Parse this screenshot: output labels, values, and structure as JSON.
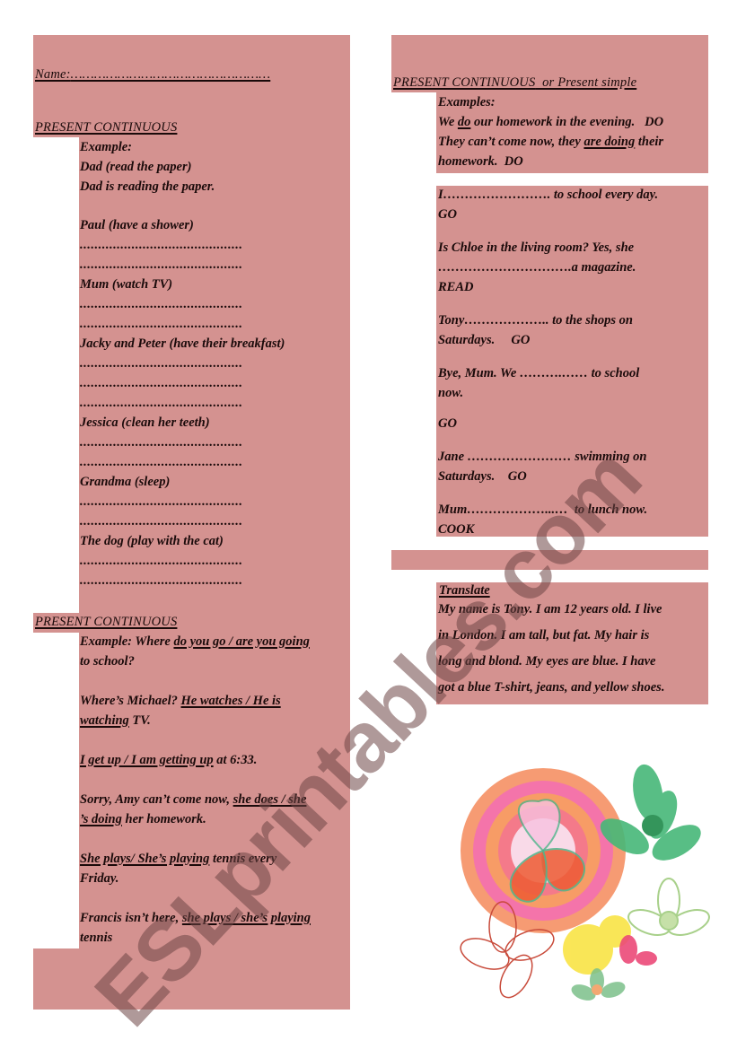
{
  "left": {
    "name_label": "Name:",
    "name_dots": "……………………………………………",
    "section1": {
      "title": "PRESENT CONTINUOUS",
      "example_label": "Example:",
      "example_prompt": "Dad (read the paper)",
      "example_answer": "Dad is reading the paper.",
      "blank": "............................................",
      "items": [
        {
          "prompt": "Paul (have a shower)",
          "blank_lines": 2
        },
        {
          "prompt": "Mum (watch TV)",
          "blank_lines": 2
        },
        {
          "prompt": "Jacky and Peter (have their breakfast)",
          "blank_lines": 3
        },
        {
          "prompt": "Jessica (clean her teeth)",
          "blank_lines": 2
        },
        {
          "prompt": "Grandma (sleep)",
          "blank_lines": 2
        },
        {
          "prompt": "The dog (play with the cat)",
          "blank_lines": 2
        }
      ]
    },
    "section2": {
      "title": "PRESENT CONTINUOUS",
      "example": {
        "pre": "Example: Where ",
        "choice": "do you go / are you going",
        "post": "",
        "line2": "to school?"
      },
      "items": [
        {
          "pre": "Where’s Michael? ",
          "choice1": "He watches / He is",
          "choice2": "watching",
          "post": " TV."
        },
        {
          "choice": "I get up / I am getting up",
          "post": " at 6:33."
        },
        {
          "pre": "Sorry, Amy can’t come now, ",
          "choice1": "she does / she",
          "choice2": "’s doing",
          "post": " her homework."
        },
        {
          "choice": "She plays/ She’s playing",
          "post": " tennis every",
          "line2": "Friday."
        },
        {
          "pre": "Francis isn’t here, ",
          "choice": "she plays / she’s playing",
          "line2": "tennis"
        }
      ]
    }
  },
  "right": {
    "section3": {
      "title_main": "PRESENT CONTINUOUS",
      "title_rest": "  or Present simple",
      "examples_label": "Examples:",
      "example1": {
        "pre": "We ",
        "u": "do",
        "post": " our homework in the evening.   DO"
      },
      "example2": {
        "pre": "They can’t come now, they ",
        "u": "are doing",
        "post": " their",
        "line2": "homework.  DO"
      }
    },
    "exercises": [
      {
        "line1": "I……………………. to school every day.",
        "line2": "GO"
      },
      {
        "line1": "Is Chloe in the living room? Yes, she",
        "line2": "………………………….a magazine.",
        "line3": "READ"
      },
      {
        "line1": "Tony……………….. to the shops on",
        "line2": "Saturdays.     GO"
      },
      {
        "line1": "Bye, Mum. We ……….…… to school",
        "line2": "now."
      },
      {
        "line1": "GO"
      },
      {
        "line1": "Jane …………………… swimming on",
        "line2": "Saturdays.    GO"
      },
      {
        "line1": "Mum………………...…  to lunch now.",
        "line2": "COOK"
      }
    ],
    "translate": {
      "title": "Translate",
      "lines": [
        "My name is Tony. I am 12 years old. I live",
        "in London. I am tall, but fat. My hair is",
        "long and blond. My eyes are blue. I have",
        "got a blue T-shirt, jeans, and yellow shoes."
      ]
    }
  },
  "watermark": "ESLprintables.com",
  "colors": {
    "box": "#d49290",
    "text": "#1a0a0a"
  }
}
